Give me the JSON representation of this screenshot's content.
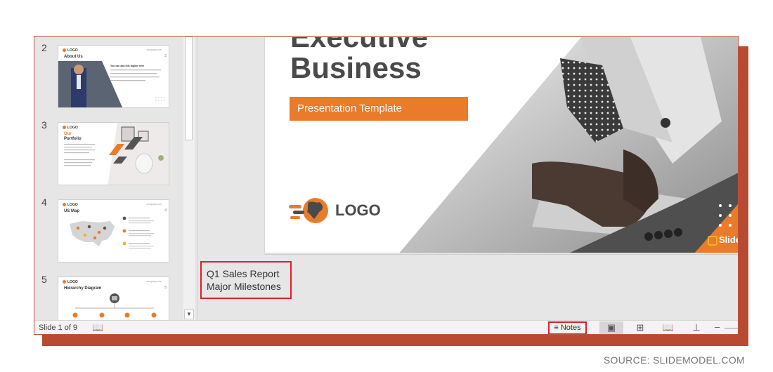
{
  "thumbnails": [
    {
      "number": "2",
      "title": "About Us",
      "logo": "LOGO",
      "slide_num": "2",
      "tagline": "You can add this tagline here",
      "website": "company.com"
    },
    {
      "number": "3",
      "title_line1": "Our",
      "title_line2": "Portfolio",
      "logo": "LOGO",
      "slide_num": "3",
      "website": "company.com"
    },
    {
      "number": "4",
      "title": "US Map",
      "logo": "LOGO",
      "slide_num": "4",
      "website": "company.com"
    },
    {
      "number": "5",
      "title": "Hierarchy Diagram",
      "logo": "LOGO",
      "slide_num": "5",
      "website": "company.com"
    }
  ],
  "slide": {
    "title_line1": "Executive",
    "title_line2": "Business",
    "banner": "Presentation Template",
    "logo": "LOGO",
    "watermark": "Slide",
    "accent_color": "#e97b2a"
  },
  "notes": {
    "line1": "Q1 Sales Report",
    "line2": "Major Milestones"
  },
  "status": {
    "slide_counter": "Slide 1 of 9",
    "notes_label": "Notes"
  },
  "source": "SOURCE: SLIDEMODEL.COM"
}
